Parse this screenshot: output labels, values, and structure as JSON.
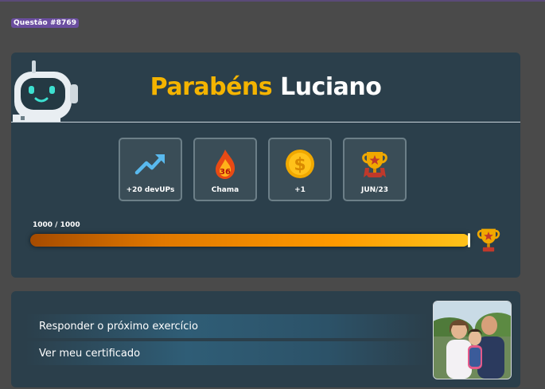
{
  "question_badge": "Questão #8769",
  "title": {
    "greeting": "Parabéns",
    "name": "Luciano"
  },
  "stats": [
    {
      "icon": "trending-up-icon",
      "label": "+20 devUPs"
    },
    {
      "icon": "flame-icon",
      "badge": "36",
      "label": "Chama"
    },
    {
      "icon": "coin-icon",
      "label": "+1"
    },
    {
      "icon": "trophy-icon",
      "label": "JUN/23"
    }
  ],
  "progress": {
    "text": "1000 / 1000",
    "value": 1000,
    "max": 1000,
    "fraction": 1.0
  },
  "actions": {
    "next_exercise": "Responder o próximo exercício",
    "certificate": "Ver meu certificado"
  },
  "colors": {
    "accent": "#f4b400",
    "card": "#2b3f4b",
    "background": "#4a4a4a",
    "badge": "#6b4ea0"
  }
}
